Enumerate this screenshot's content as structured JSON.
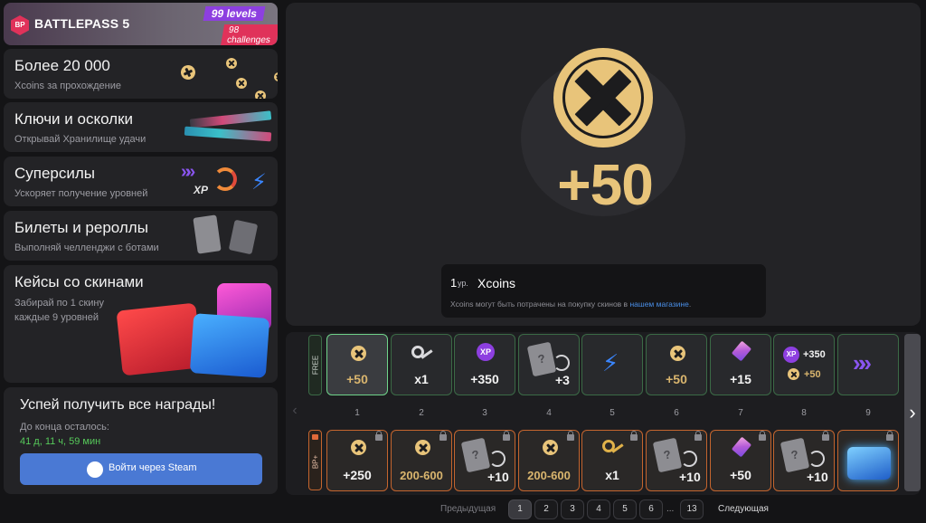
{
  "battlepass": {
    "label": "BATTLEPASS 5",
    "badge": "BP",
    "levels": "99 levels",
    "challenges": "98 challenges"
  },
  "features": [
    {
      "title": "Более 20 000",
      "subtitle": "Xcoins за прохождение"
    },
    {
      "title": "Ключи и осколки",
      "subtitle": "Открывай Хранилище удачи"
    },
    {
      "title": "Суперсилы",
      "subtitle": "Ускоряет получение уровней"
    },
    {
      "title": "Билеты и рероллы",
      "subtitle": "Выполняй челленджи с ботами"
    },
    {
      "title": "Кейсы со скинами",
      "subtitle_line1": "Забирай по 1 скину",
      "subtitle_line2": "каждые 9 уровней"
    }
  ],
  "superpower_xp": "XP",
  "promo": {
    "title": "Успей получить все награды!",
    "countdown_label": "До конца осталось:",
    "countdown": "41 д, 11 ч, 59 мин",
    "steam_button": "Войти через Steam"
  },
  "preview": {
    "amount": "+50",
    "level_num": "1",
    "level_unit": "ур.",
    "item_name": "Xcoins",
    "description": "Xcoins могут быть потрачены на покупку скинов в",
    "link": "нашем магазине",
    "desc_end": "."
  },
  "tracks": {
    "free_label": "FREE",
    "paid_label": "BP+"
  },
  "free_rewards": [
    {
      "type": "coin",
      "value": "+50"
    },
    {
      "type": "key",
      "value": "x1"
    },
    {
      "type": "xp",
      "icon": "XP",
      "value": "+350"
    },
    {
      "type": "ticket",
      "icon": "?",
      "value": "+3"
    },
    {
      "type": "bolt",
      "value": ""
    },
    {
      "type": "coin",
      "value": "+50"
    },
    {
      "type": "gem",
      "value": "+15"
    },
    {
      "type": "combo",
      "icon": "XP",
      "value": "+350",
      "value2": "+50"
    },
    {
      "type": "chevron",
      "value": ""
    }
  ],
  "level_numbers": [
    "1",
    "2",
    "3",
    "4",
    "5",
    "6",
    "7",
    "8",
    "9"
  ],
  "paid_rewards": [
    {
      "type": "coin",
      "value": "+250"
    },
    {
      "type": "coin",
      "value": "200-600"
    },
    {
      "type": "ticket",
      "icon": "?",
      "value": "+10"
    },
    {
      "type": "coin",
      "value": "200-600"
    },
    {
      "type": "key",
      "value": "x1"
    },
    {
      "type": "ticket",
      "icon": "?",
      "value": "+10"
    },
    {
      "type": "gem",
      "value": "+50"
    },
    {
      "type": "ticket",
      "icon": "?",
      "value": "+10"
    },
    {
      "type": "case",
      "value": ""
    }
  ],
  "pagination": {
    "prev": "Предыдущая",
    "next": "Следующая",
    "pages": [
      "1",
      "2",
      "3",
      "4",
      "5",
      "6"
    ],
    "ellipsis": "...",
    "last": "13",
    "current": "1"
  },
  "colors": {
    "accent_gold": "#e8c47a",
    "free_border": "#3b6a46",
    "paid_border": "#c4652e",
    "steam_button": "#4a79d4",
    "countdown": "#56c95a",
    "link": "#4a8fe8"
  }
}
